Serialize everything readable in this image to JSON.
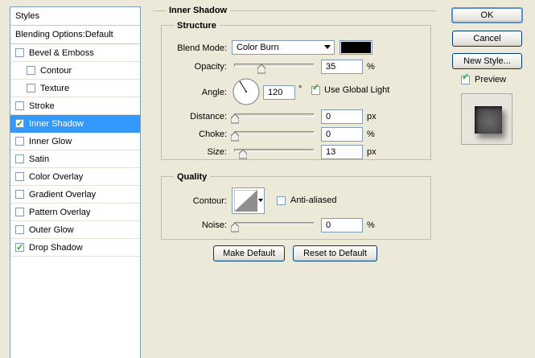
{
  "left_panel": {
    "header": "Styles",
    "blending_options": "Blending Options:Default",
    "items": [
      {
        "label": "Bevel & Emboss",
        "checked": false,
        "selected": false,
        "indent": false
      },
      {
        "label": "Contour",
        "checked": false,
        "selected": false,
        "indent": true
      },
      {
        "label": "Texture",
        "checked": false,
        "selected": false,
        "indent": true
      },
      {
        "label": "Stroke",
        "checked": false,
        "selected": false,
        "indent": false
      },
      {
        "label": "Inner Shadow",
        "checked": true,
        "selected": true,
        "indent": false
      },
      {
        "label": "Inner Glow",
        "checked": false,
        "selected": false,
        "indent": false
      },
      {
        "label": "Satin",
        "checked": false,
        "selected": false,
        "indent": false
      },
      {
        "label": "Color Overlay",
        "checked": false,
        "selected": false,
        "indent": false
      },
      {
        "label": "Gradient Overlay",
        "checked": false,
        "selected": false,
        "indent": false
      },
      {
        "label": "Pattern Overlay",
        "checked": false,
        "selected": false,
        "indent": false
      },
      {
        "label": "Outer Glow",
        "checked": false,
        "selected": false,
        "indent": false
      },
      {
        "label": "Drop Shadow",
        "checked": true,
        "selected": false,
        "indent": false
      }
    ]
  },
  "inner_shadow": {
    "title": "Inner Shadow",
    "structure": {
      "title": "Structure",
      "blend_mode_label": "Blend Mode:",
      "blend_mode_value": "Color Burn",
      "shadow_color": "#000000",
      "opacity_label": "Opacity:",
      "opacity_value": "35",
      "opacity_unit": "%",
      "angle_label": "Angle:",
      "angle_value": "120",
      "angle_unit": "°",
      "global_light_label": "Use Global Light",
      "global_light_checked": true,
      "distance_label": "Distance:",
      "distance_value": "0",
      "distance_unit": "px",
      "choke_label": "Choke:",
      "choke_value": "0",
      "choke_unit": "%",
      "size_label": "Size:",
      "size_value": "13",
      "size_unit": "px"
    },
    "quality": {
      "title": "Quality",
      "contour_label": "Contour:",
      "antialiased_label": "Anti-aliased",
      "antialiased_checked": false,
      "noise_label": "Noise:",
      "noise_value": "0",
      "noise_unit": "%"
    },
    "make_default_label": "Make Default",
    "reset_default_label": "Reset to Default"
  },
  "right_buttons": {
    "ok_label": "OK",
    "cancel_label": "Cancel",
    "new_style_label": "New Style...",
    "preview_label": "Preview",
    "preview_checked": true
  },
  "colors": {
    "selection": "#3399ff",
    "dialog_bg": "#ece9d8"
  }
}
